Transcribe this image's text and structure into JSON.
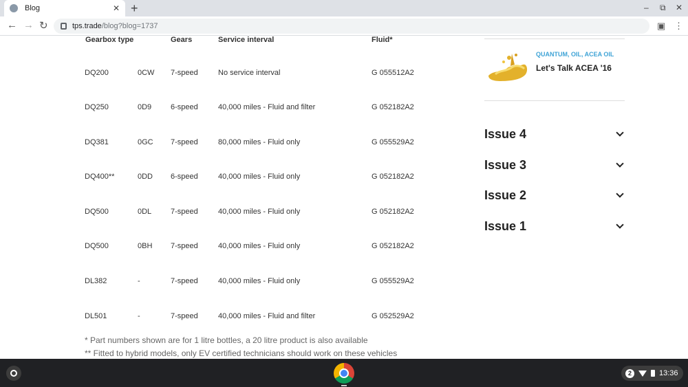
{
  "browser": {
    "tab_title": "Blog",
    "tab_close": "✕",
    "new_tab": "+",
    "url_host": "tps.trade",
    "url_path": "/blog?blog=1737",
    "minimize": "–",
    "restore": "⧉",
    "close": "✕"
  },
  "table": {
    "headers": {
      "gearbox": "Gearbox type",
      "gears": "Gears",
      "service": "Service interval",
      "fluid": "Fluid*"
    },
    "rows": [
      {
        "model": "DQ200",
        "code": "0CW",
        "gears": "7-speed",
        "service": "No service interval",
        "fluid": "G 055512A2"
      },
      {
        "model": "DQ250",
        "code": "0D9",
        "gears": "6-speed",
        "service": "40,000 miles - Fluid and filter",
        "fluid": "G 052182A2"
      },
      {
        "model": "DQ381",
        "code": "0GC",
        "gears": "7-speed",
        "service": "80,000 miles - Fluid only",
        "fluid": "G 055529A2"
      },
      {
        "model": "DQ400**",
        "code": "0DD",
        "gears": "6-speed",
        "service": "40,000 miles - Fluid only",
        "fluid": "G 052182A2"
      },
      {
        "model": "DQ500",
        "code": "0DL",
        "gears": "7-speed",
        "service": "40,000 miles - Fluid only",
        "fluid": "G 052182A2"
      },
      {
        "model": "DQ500",
        "code": "0BH",
        "gears": "7-speed",
        "service": "40,000 miles - Fluid only",
        "fluid": "G 052182A2"
      },
      {
        "model": "DL382",
        "code": "-",
        "gears": "7-speed",
        "service": "40,000 miles - Fluid only",
        "fluid": "G 055529A2"
      },
      {
        "model": "DL501",
        "code": "-",
        "gears": "7-speed",
        "service": "40,000 miles - Fluid and filter",
        "fluid": "G 052529A2"
      }
    ],
    "note1": "* Part numbers shown are for 1 litre bottles, a 20 litre product is also available",
    "note2": "** Fitted to hybrid models, only EV certified technicians should work on these vehicles"
  },
  "sidebar": {
    "card_tags": "QUANTUM, OIL, ACEA OIL",
    "card_title": "Let's Talk ACEA '16",
    "issues": [
      "Issue 4",
      "Issue 3",
      "Issue 2",
      "Issue 1"
    ]
  },
  "shelf": {
    "notification_count": "2",
    "time": "13:36"
  },
  "colors": {
    "tag_accent": "#3ea3d6"
  }
}
